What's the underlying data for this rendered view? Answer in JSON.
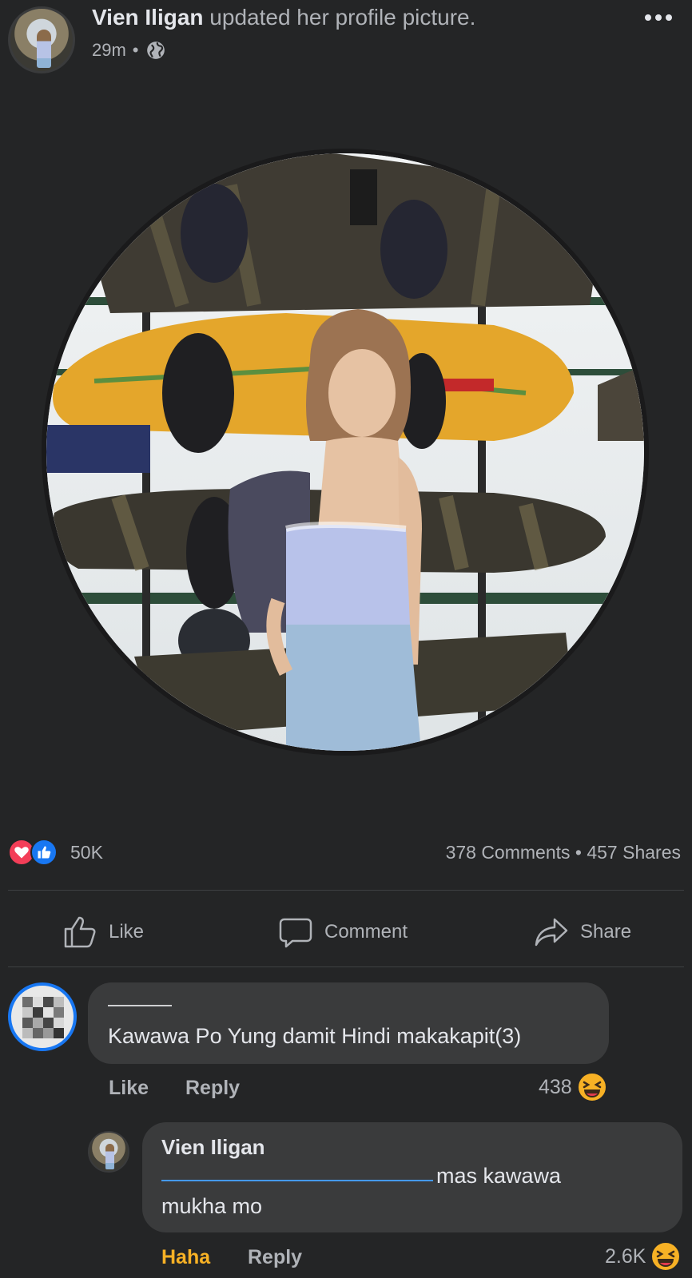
{
  "post": {
    "author_name": "Vien Iligan",
    "action_text": " updated her profile picture.",
    "time": "29m",
    "privacy_separator": "•"
  },
  "stats": {
    "reactions_count": "50K",
    "comments_and_shares": "378 Comments • 457 Shares"
  },
  "actions": {
    "like_label": "Like",
    "comment_label": "Comment",
    "share_label": "Share"
  },
  "comments": [
    {
      "text": "Kawawa Po Yung damit Hindi makakapit(3)",
      "like_label": "Like",
      "reply_label": "Reply",
      "reaction_count": "438"
    },
    {
      "author": "Vien Iligan",
      "text_line1": "mas kawawa",
      "text_line2": "mukha mo",
      "reaction_label": "Haha",
      "reply_label": "Reply",
      "reaction_count": "2.6K"
    }
  ],
  "colors": {
    "background": "#242526",
    "bubble": "#3a3b3c",
    "like_blue": "#1877f2",
    "love_red": "#f33e58",
    "haha_orange": "#f7b125",
    "muted_text": "#b0b3b8"
  },
  "icons": [
    "globe-icon",
    "more-options-icon",
    "love-reaction-icon",
    "like-reaction-icon",
    "like-icon",
    "comment-icon",
    "share-icon",
    "haha-icon"
  ]
}
